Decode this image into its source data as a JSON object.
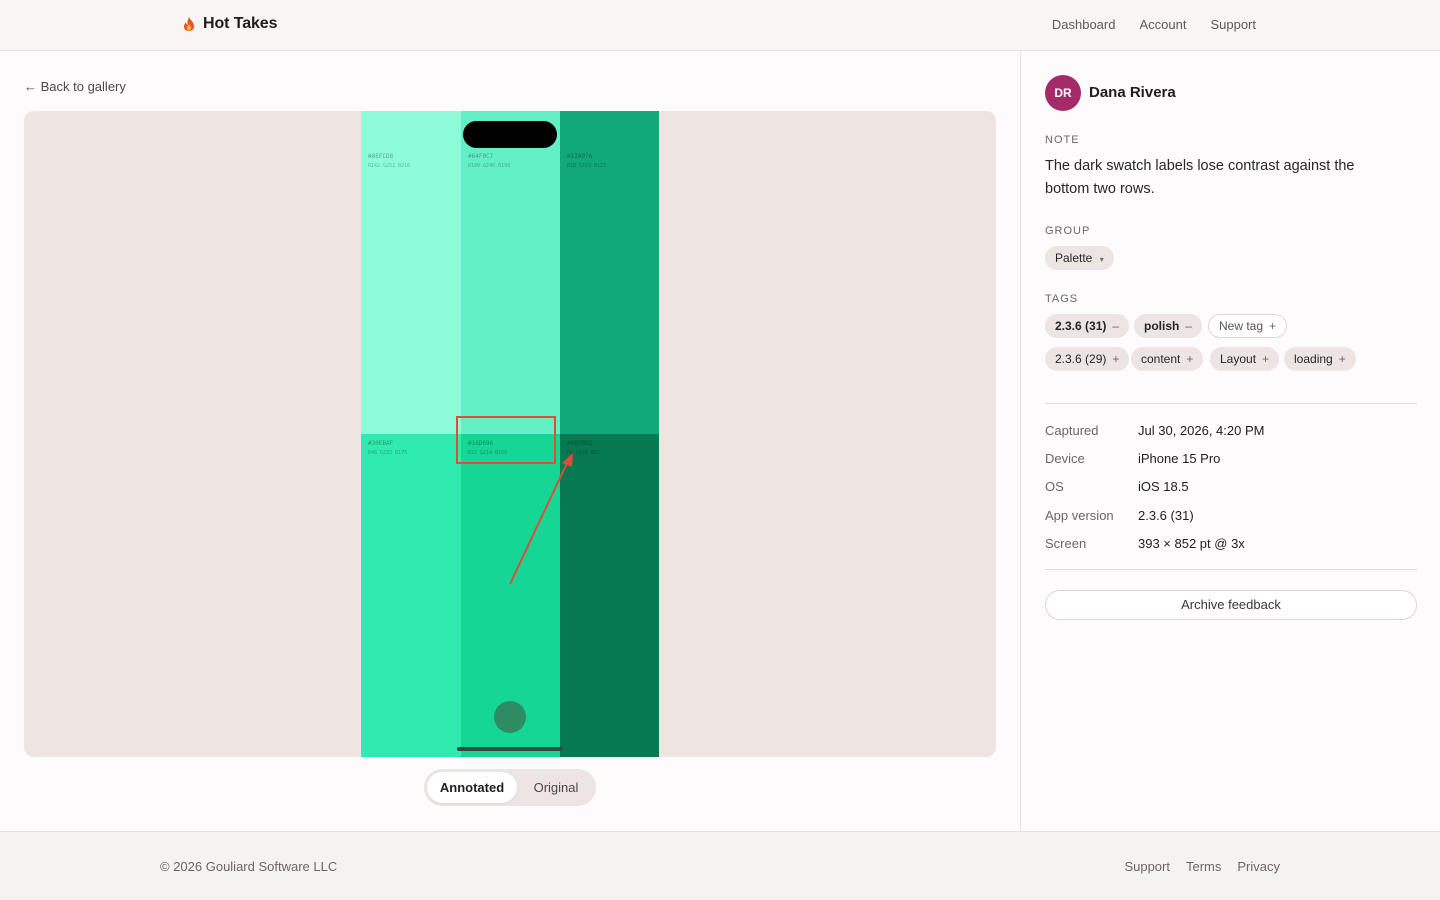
{
  "header": {
    "brand_name": "Hot Takes",
    "nav": [
      "Dashboard",
      "Account",
      "Support"
    ]
  },
  "main": {
    "back_label": "← Back to gallery",
    "screenshot": {
      "swatches": [
        {
          "hex": "#8EFCD8",
          "rgb": "R142 G252 B216",
          "color": "#8efcd8"
        },
        {
          "hex": "#64F0C7",
          "rgb": "R100 G240 B199",
          "color": "#64f0c7"
        },
        {
          "hex": "#12A97A",
          "rgb": "R18 G169 B122",
          "color": "#12a97a"
        },
        {
          "hex": "#30EBAF",
          "rgb": "R48 G235 B175",
          "color": "#30ebaf"
        },
        {
          "hex": "#16D696",
          "rgb": "R22 G214 B150",
          "color": "#16d696"
        },
        {
          "hex": "#067952",
          "rgb": "R6 G121 B82",
          "color": "#067952"
        }
      ],
      "annotation_color": "#e04b3a"
    },
    "toggle": {
      "active": "Annotated",
      "inactive": "Original"
    }
  },
  "sidebar": {
    "avatar_initials": "DR",
    "avatar_color": "#a52a6a",
    "user_name": "Dana Rivera",
    "note_label": "NOTE",
    "note_text": "The dark swatch labels lose contrast against the bottom two rows.",
    "group_label": "GROUP",
    "group_value": "Palette",
    "group_caret": "▾",
    "tags_label": "TAGS",
    "tags_row1": [
      {
        "label": "2.3.6 (31)",
        "op": "–"
      },
      {
        "label": "polish",
        "op": "–"
      },
      {
        "label": "New tag",
        "op": "+"
      }
    ],
    "tags_row2": [
      {
        "label": "2.3.6 (29)",
        "op": "+"
      },
      {
        "label": "content",
        "op": "+"
      },
      {
        "label": "Layout",
        "op": "+"
      },
      {
        "label": "loading",
        "op": "+"
      }
    ],
    "meta": [
      {
        "key": "Captured",
        "value": "Jul 30, 2026, 4:20 PM"
      },
      {
        "key": "Device",
        "value": "iPhone 15 Pro"
      },
      {
        "key": "OS",
        "value": "iOS 18.5"
      },
      {
        "key": "App version",
        "value": "2.3.6 (31)"
      },
      {
        "key": "Screen",
        "value": "393 × 852 pt @ 3x"
      }
    ],
    "archive_label": "Archive feedback"
  },
  "footer": {
    "copyright": "© 2026 Gouliard Software LLC",
    "links": [
      "Support",
      "Terms",
      "Privacy"
    ]
  }
}
